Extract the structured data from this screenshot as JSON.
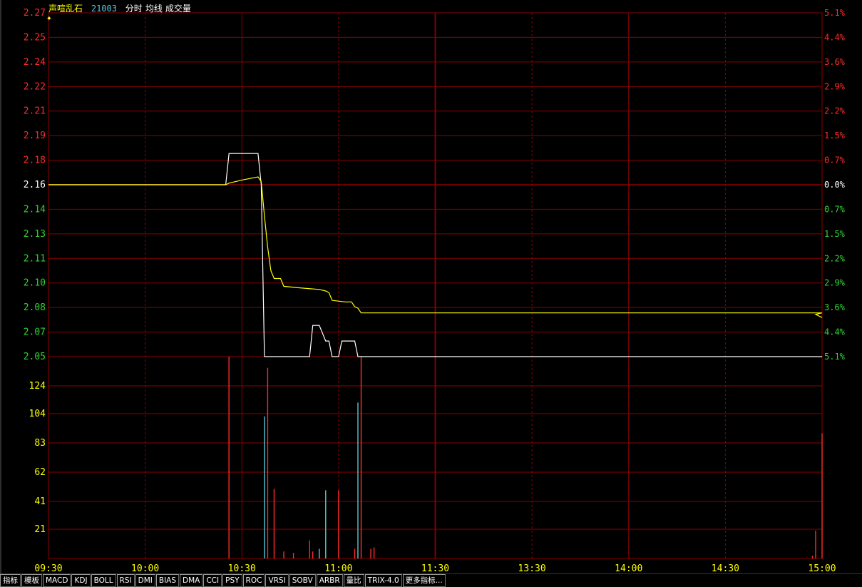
{
  "header": {
    "name": "声喧乱石",
    "code": "21003",
    "items": [
      "分时",
      "均线",
      "成交量"
    ]
  },
  "colors": {
    "grid": "#8b0000",
    "up": "#ff2a2a",
    "down": "#2fd62f",
    "price_line": "#ffffff",
    "avg_line": "#ffff00",
    "vol_up": "#ff2a2a",
    "vol_down": "#57c7d4",
    "axis_text": "#ffffff"
  },
  "chart_data": {
    "type": "line",
    "prev_close": 2.16,
    "price_axis": {
      "ticks": [
        "2.27",
        "2.25",
        "2.24",
        "2.22",
        "2.21",
        "2.19",
        "2.18",
        "2.16",
        "2.14",
        "2.13",
        "2.11",
        "2.10",
        "2.08",
        "2.07",
        "2.05"
      ],
      "ylim": [
        2.05,
        2.27
      ]
    },
    "pct_axis": {
      "ticks": [
        "5.1%",
        "4.4%",
        "3.6%",
        "2.9%",
        "2.2%",
        "1.5%",
        "0.7%",
        "0.0%",
        "0.7%",
        "1.5%",
        "2.2%",
        "2.9%",
        "3.6%",
        "4.4%",
        "5.1%"
      ]
    },
    "volume_axis": {
      "ticks": [
        "124",
        "104",
        "83",
        "62",
        "41",
        "21"
      ],
      "ylim": [
        0,
        145
      ]
    },
    "time_axis": {
      "labels": [
        "09:30",
        "10:00",
        "10:30",
        "11:00",
        "11:30",
        "13:30",
        "14:00",
        "14:30",
        "15:00"
      ],
      "total_minutes": 240
    },
    "series": [
      {
        "points": [
          [
            0,
            2.16
          ],
          [
            55,
            2.16
          ],
          [
            56,
            2.18
          ],
          [
            65,
            2.18
          ],
          [
            66,
            2.16
          ],
          [
            67,
            2.05
          ],
          [
            81,
            2.05
          ],
          [
            82,
            2.07
          ],
          [
            84,
            2.07
          ],
          [
            86,
            2.06
          ],
          [
            87,
            2.06
          ],
          [
            88,
            2.05
          ],
          [
            90,
            2.05
          ],
          [
            91,
            2.06
          ],
          [
            95,
            2.06
          ],
          [
            96,
            2.05
          ],
          [
            240,
            2.05
          ]
        ]
      },
      {
        "points": [
          [
            0,
            2.16
          ],
          [
            55,
            2.16
          ],
          [
            56,
            2.161
          ],
          [
            60,
            2.163
          ],
          [
            65,
            2.165
          ],
          [
            66,
            2.162
          ],
          [
            67,
            2.14
          ],
          [
            68,
            2.12
          ],
          [
            69,
            2.105
          ],
          [
            70,
            2.1
          ],
          [
            72,
            2.1
          ],
          [
            73,
            2.095
          ],
          [
            78,
            2.094
          ],
          [
            84,
            2.093
          ],
          [
            86,
            2.092
          ],
          [
            87,
            2.091
          ],
          [
            88,
            2.086
          ],
          [
            92,
            2.085
          ],
          [
            94,
            2.085
          ],
          [
            95,
            2.082
          ],
          [
            96,
            2.081
          ],
          [
            97,
            2.078
          ],
          [
            240,
            2.078
          ],
          [
            238,
            2.077
          ],
          [
            240,
            2.075
          ]
        ]
      }
    ],
    "volume": [
      {
        "t": 56,
        "v": 145,
        "dir": "up"
      },
      {
        "t": 67,
        "v": 102,
        "dir": "down"
      },
      {
        "t": 68,
        "v": 137,
        "dir": "up"
      },
      {
        "t": 70,
        "v": 50,
        "dir": "up"
      },
      {
        "t": 73,
        "v": 5,
        "dir": "up"
      },
      {
        "t": 76,
        "v": 4,
        "dir": "up"
      },
      {
        "t": 81,
        "v": 13,
        "dir": "up"
      },
      {
        "t": 82,
        "v": 5,
        "dir": "up"
      },
      {
        "t": 84,
        "v": 7,
        "dir": "down"
      },
      {
        "t": 86,
        "v": 49,
        "dir": "down"
      },
      {
        "t": 90,
        "v": 49,
        "dir": "up"
      },
      {
        "t": 95,
        "v": 7,
        "dir": "up"
      },
      {
        "t": 96,
        "v": 112,
        "dir": "down"
      },
      {
        "t": 97,
        "v": 145,
        "dir": "up"
      },
      {
        "t": 100,
        "v": 7,
        "dir": "up"
      },
      {
        "t": 101,
        "v": 8,
        "dir": "up"
      },
      {
        "t": 237,
        "v": 2,
        "dir": "up"
      },
      {
        "t": 238,
        "v": 20,
        "dir": "up"
      },
      {
        "t": 240,
        "v": 90,
        "dir": "up"
      }
    ]
  },
  "tabs": [
    "指标",
    "模板",
    "MACD",
    "KDJ",
    "BOLL",
    "RSI",
    "DMI",
    "BIAS",
    "DMA",
    "CCI",
    "PSY",
    "ROC",
    "VRSI",
    "SOBV",
    "ARBR",
    "量比",
    "TRIX-4.0",
    "更多指标..."
  ]
}
